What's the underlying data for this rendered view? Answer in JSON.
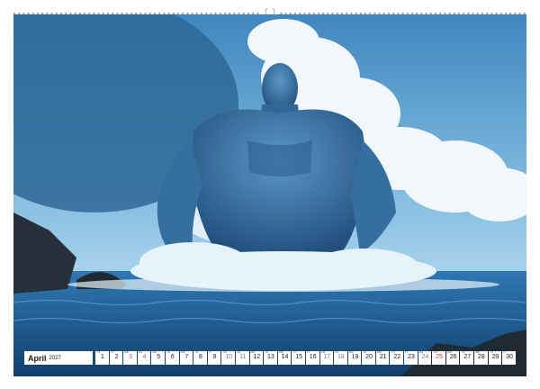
{
  "calendar": {
    "month": "April",
    "year": "2027",
    "days": [
      {
        "n": "1",
        "wd": "Th",
        "type": "weekday"
      },
      {
        "n": "2",
        "wd": "Fr",
        "type": "weekday"
      },
      {
        "n": "3",
        "wd": "Sa",
        "type": "weekend"
      },
      {
        "n": "4",
        "wd": "Su",
        "type": "weekend"
      },
      {
        "n": "5",
        "wd": "Mo",
        "type": "weekday"
      },
      {
        "n": "6",
        "wd": "Tu",
        "type": "weekday"
      },
      {
        "n": "7",
        "wd": "We",
        "type": "weekday"
      },
      {
        "n": "8",
        "wd": "Th",
        "type": "weekday"
      },
      {
        "n": "9",
        "wd": "Fr",
        "type": "weekday"
      },
      {
        "n": "10",
        "wd": "Sa",
        "type": "weekend"
      },
      {
        "n": "11",
        "wd": "Su",
        "type": "weekend"
      },
      {
        "n": "12",
        "wd": "Mo",
        "type": "weekday"
      },
      {
        "n": "13",
        "wd": "Tu",
        "type": "weekday"
      },
      {
        "n": "14",
        "wd": "We",
        "type": "weekday"
      },
      {
        "n": "15",
        "wd": "Th",
        "type": "weekday"
      },
      {
        "n": "16",
        "wd": "Fr",
        "type": "weekday"
      },
      {
        "n": "17",
        "wd": "Sa",
        "type": "weekend"
      },
      {
        "n": "18",
        "wd": "Su",
        "type": "weekend"
      },
      {
        "n": "19",
        "wd": "Mo",
        "type": "weekday"
      },
      {
        "n": "20",
        "wd": "Tu",
        "type": "weekday"
      },
      {
        "n": "21",
        "wd": "We",
        "type": "weekday"
      },
      {
        "n": "22",
        "wd": "Th",
        "type": "weekday"
      },
      {
        "n": "23",
        "wd": "Fr",
        "type": "weekday"
      },
      {
        "n": "24",
        "wd": "Sa",
        "type": "weekend"
      },
      {
        "n": "25",
        "wd": "Su",
        "type": "holiday"
      },
      {
        "n": "26",
        "wd": "Mo",
        "type": "weekday"
      },
      {
        "n": "27",
        "wd": "Tu",
        "type": "weekday"
      },
      {
        "n": "28",
        "wd": "We",
        "type": "weekday"
      },
      {
        "n": "29",
        "wd": "Th",
        "type": "weekday"
      },
      {
        "n": "30",
        "wd": "Fr",
        "type": "weekday"
      }
    ]
  },
  "image": {
    "subject": "blue-giant-rising-from-sea",
    "colors": {
      "sky": "#5f9fce",
      "sea": "#1f5f9a",
      "figure": "#3f7fb6",
      "foam": "#e6f3fb"
    }
  }
}
